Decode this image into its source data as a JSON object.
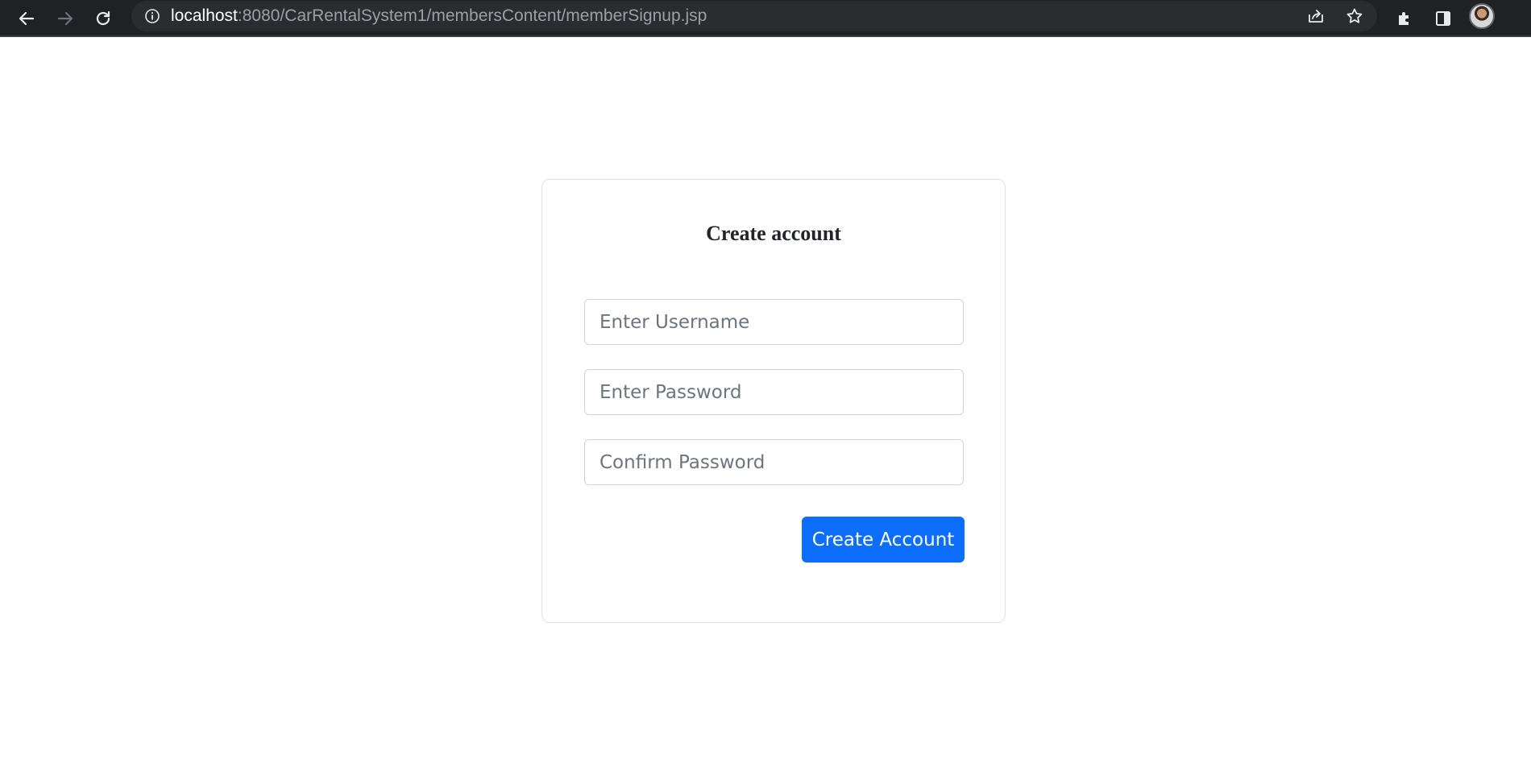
{
  "browser": {
    "url_host": "localhost",
    "url_path": ":8080/CarRentalSystem1/membersContent/memberSignup.jsp",
    "icons": {
      "back": "back-arrow-icon",
      "forward": "forward-arrow-icon",
      "reload": "reload-icon",
      "site_info": "info-icon",
      "share": "share-icon",
      "bookmark": "star-icon",
      "extensions": "puzzle-icon",
      "side_panel": "side-panel-icon"
    }
  },
  "signup": {
    "title": "Create account",
    "username_placeholder": "Enter Username",
    "password_placeholder": "Enter Password",
    "confirm_placeholder": "Confirm Password",
    "submit_label": "Create Account"
  },
  "colors": {
    "primary": "#0d6efd",
    "chrome_bg": "#202124"
  }
}
